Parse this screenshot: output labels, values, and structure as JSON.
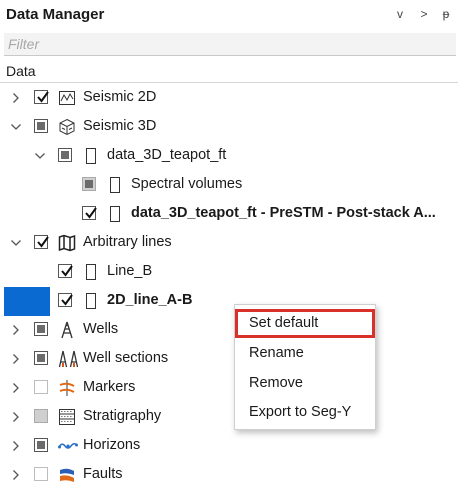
{
  "panel": {
    "title": "Data Manager",
    "buttons": [
      "v",
      ">",
      "ᵽ"
    ]
  },
  "filter": {
    "placeholder": "Filter"
  },
  "column_header": "Data",
  "tree": [
    {
      "label": "Seismic 2D",
      "expand": "collapsed",
      "check": "checked",
      "icon": "seismic-2d-icon"
    },
    {
      "label": "Seismic 3D",
      "expand": "expanded",
      "check": "partial",
      "icon": "seismic-3d-icon"
    },
    {
      "label": "data_3D_teapot_ft",
      "expand": "expanded",
      "check": "partial",
      "icon": "document-icon"
    },
    {
      "label": "Spectral volumes",
      "expand": "none",
      "check": "partial-grey",
      "icon": "document-icon"
    },
    {
      "label": "data_3D_teapot_ft - PreSTM - Post-stack A...",
      "expand": "none",
      "check": "checked",
      "icon": "document-icon",
      "bold": true
    },
    {
      "label": "Arbitrary lines",
      "expand": "expanded",
      "check": "checked",
      "icon": "map-icon"
    },
    {
      "label": "Line_B",
      "expand": "none",
      "check": "checked",
      "icon": "document-icon"
    },
    {
      "label": "2D_line_A-B",
      "expand": "none",
      "check": "checked",
      "icon": "document-icon",
      "bold": true,
      "selected": true
    },
    {
      "label": "Wells",
      "expand": "collapsed",
      "check": "partial",
      "icon": "well-icon"
    },
    {
      "label": "Well sections",
      "expand": "collapsed",
      "check": "partial",
      "icon": "well-sections-icon"
    },
    {
      "label": "Markers",
      "expand": "collapsed",
      "check": "unchecked",
      "icon": "markers-icon"
    },
    {
      "label": "Stratigraphy",
      "expand": "collapsed",
      "check": "grey",
      "icon": "stratigraphy-icon"
    },
    {
      "label": "Horizons",
      "expand": "collapsed",
      "check": "partial",
      "icon": "horizons-icon"
    },
    {
      "label": "Faults",
      "expand": "collapsed",
      "check": "unchecked",
      "icon": "faults-icon"
    }
  ],
  "context_menu": {
    "items": [
      "Set default",
      "Rename",
      "Remove",
      "Export to Seg-Y"
    ],
    "highlighted": "Set default"
  },
  "colors": {
    "selection": "#0a6ad2",
    "highlight_border": "#d9302a"
  }
}
